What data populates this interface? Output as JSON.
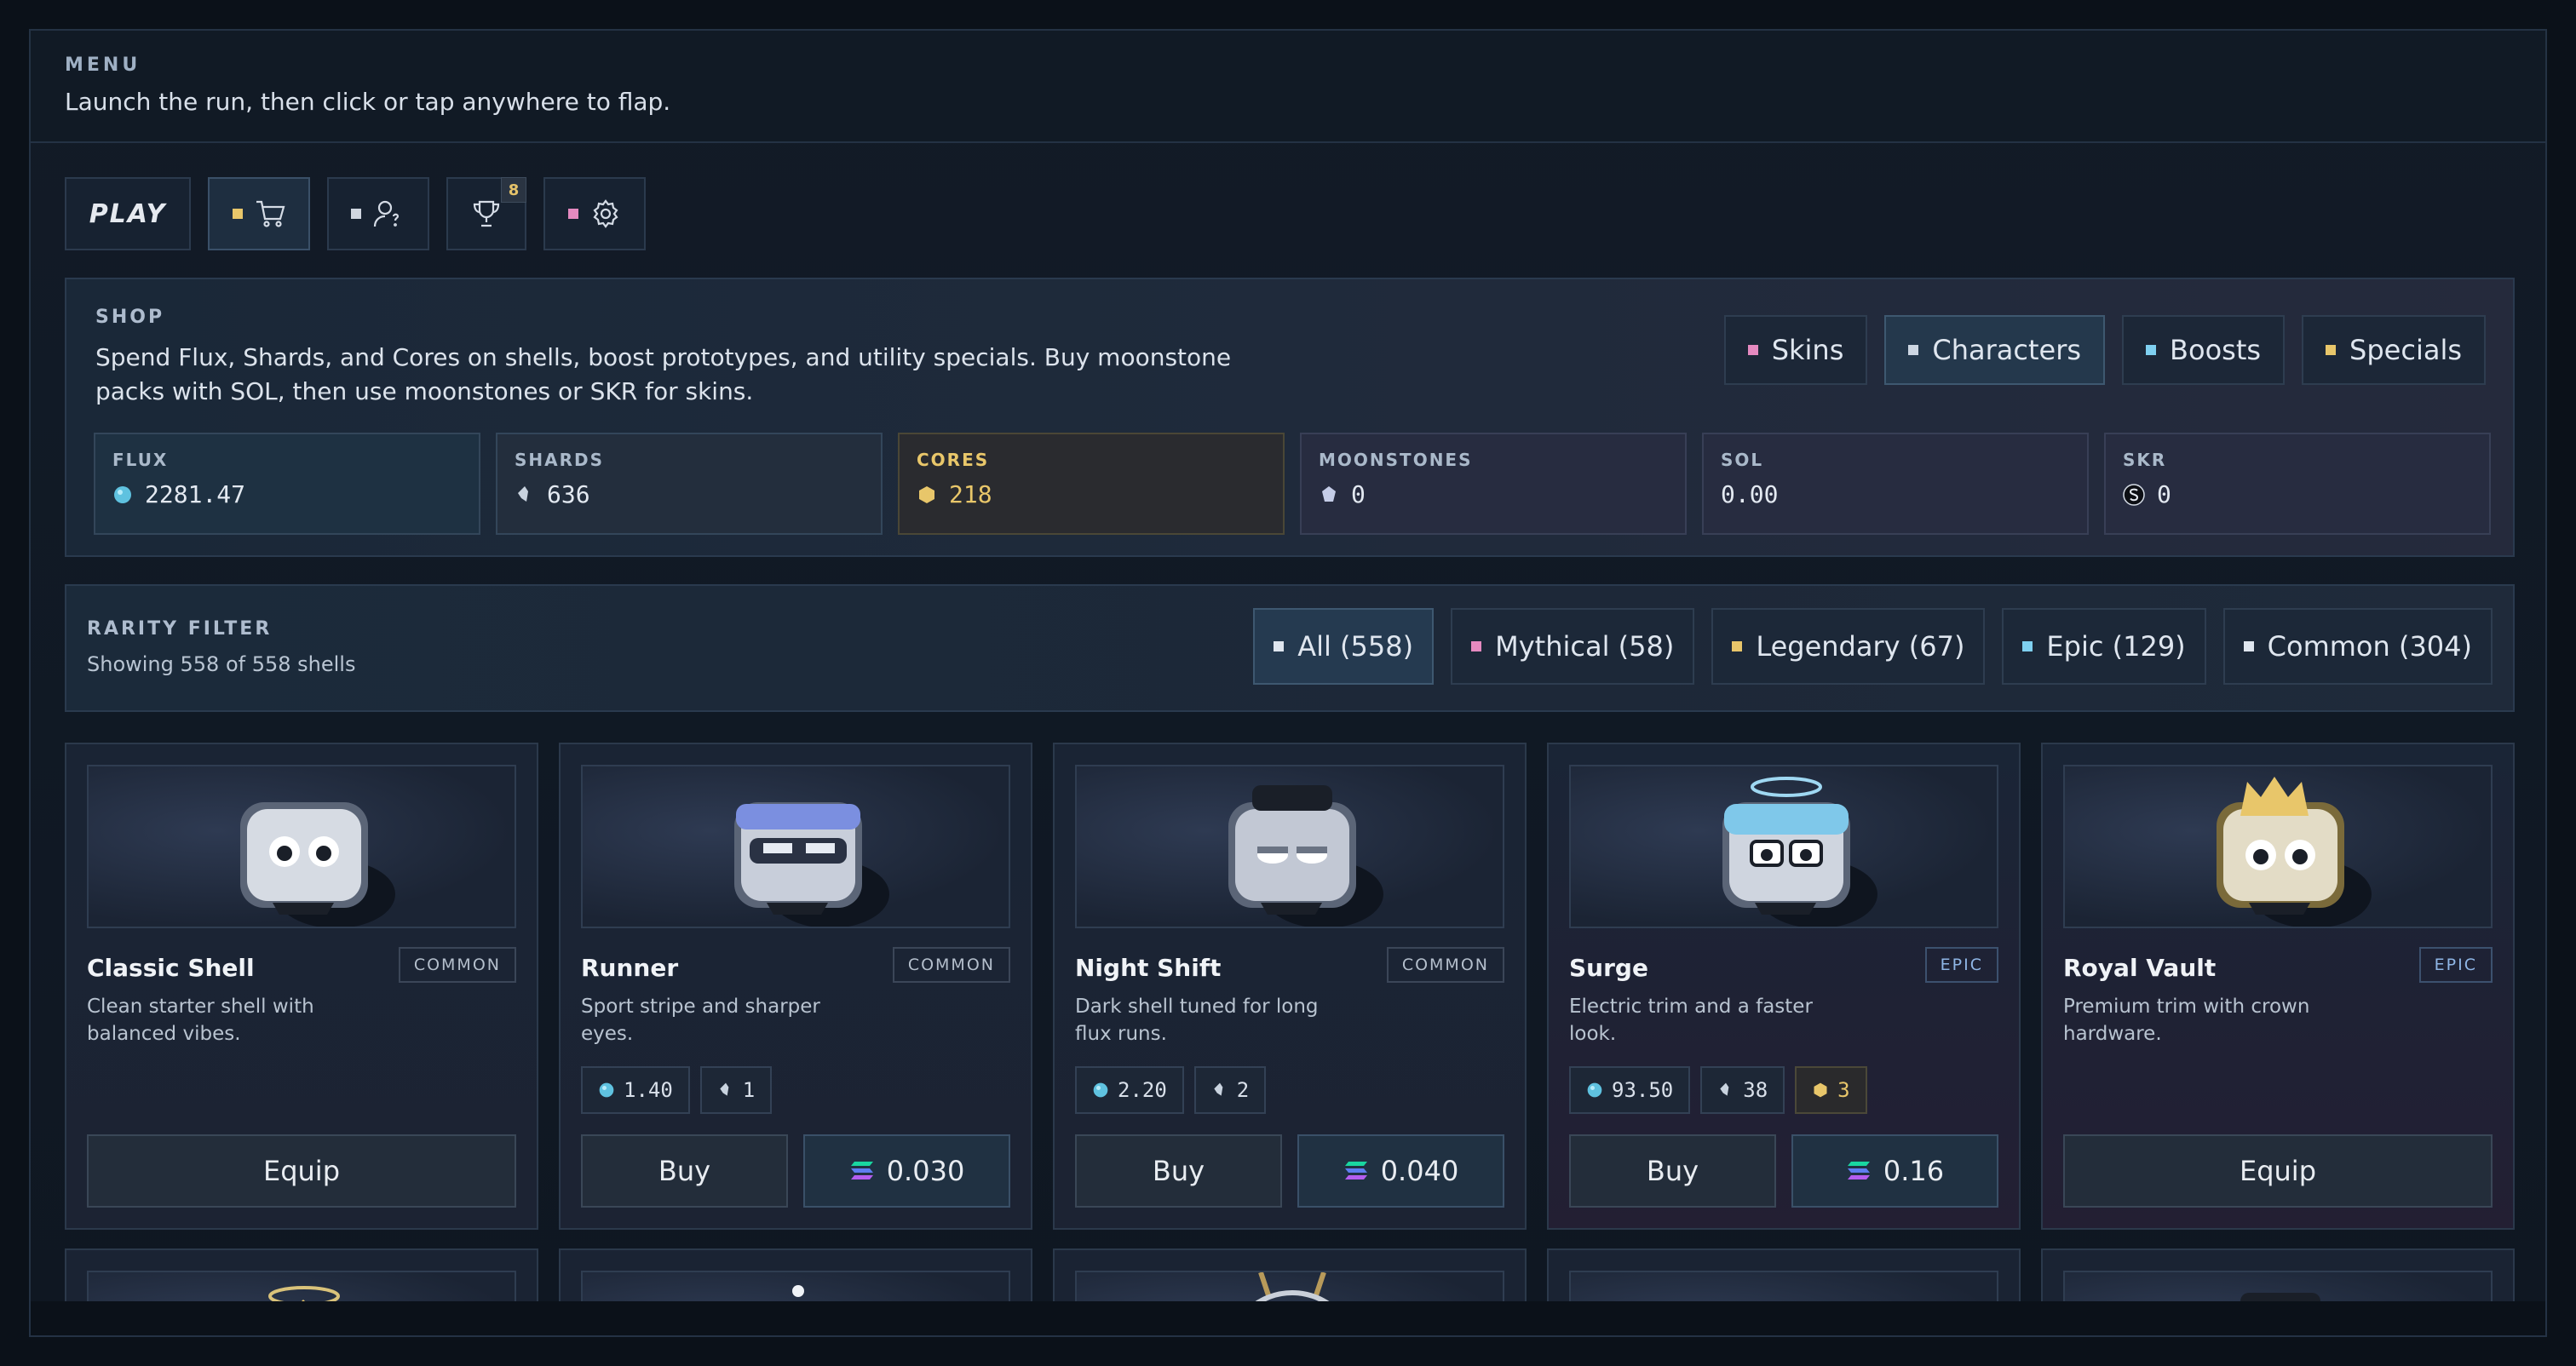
{
  "menu": {
    "kicker": "MENU",
    "description": "Launch the run, then click or tap anywhere to flap."
  },
  "toolbar": {
    "play_label": "PLAY",
    "achievements_badge": "8"
  },
  "shop": {
    "kicker": "SHOP",
    "description": "Spend Flux, Shards, and Cores on shells, boost prototypes, and utility specials. Buy moonstone packs with SOL, then use moonstones or SKR for skins.",
    "tabs": [
      "Skins",
      "Characters",
      "Boosts",
      "Specials"
    ],
    "active_tab": "Characters",
    "currencies": [
      {
        "label": "FLUX",
        "value": "2281.47"
      },
      {
        "label": "SHARDS",
        "value": "636"
      },
      {
        "label": "CORES",
        "value": "218"
      },
      {
        "label": "MOONSTONES",
        "value": "0"
      },
      {
        "label": "SOL",
        "value": "0.00"
      },
      {
        "label": "SKR",
        "value": "0"
      }
    ]
  },
  "rarity": {
    "kicker": "RARITY FILTER",
    "status": "Showing 558 of 558 shells",
    "tabs": [
      "All (558)",
      "Mythical (58)",
      "Legendary (67)",
      "Epic (129)",
      "Common (304)"
    ]
  },
  "cards": [
    {
      "name": "Classic Shell",
      "rarity": "COMMON",
      "desc": "Clean starter shell with balanced vibes.",
      "action": "Equip"
    },
    {
      "name": "Runner",
      "rarity": "COMMON",
      "desc": "Sport stripe and sharper eyes.",
      "flux": "1.40",
      "shards": "1",
      "action": "Buy",
      "sol": "0.030"
    },
    {
      "name": "Night Shift",
      "rarity": "COMMON",
      "desc": "Dark shell tuned for long flux runs.",
      "flux": "2.20",
      "shards": "2",
      "action": "Buy",
      "sol": "0.040"
    },
    {
      "name": "Surge",
      "rarity": "EPIC",
      "desc": "Electric trim and a faster look.",
      "flux": "93.50",
      "shards": "38",
      "cores": "3",
      "action": "Buy",
      "sol": "0.16"
    },
    {
      "name": "Royal Vault",
      "rarity": "EPIC",
      "desc": "Premium trim with crown hardware.",
      "action": "Equip"
    }
  ],
  "colors": {
    "flux": "#5fc2e0",
    "core": "#e8c66a",
    "mythical": "#e58ac0",
    "epic": "#7fd0f0",
    "common": "#d0d6e0"
  }
}
